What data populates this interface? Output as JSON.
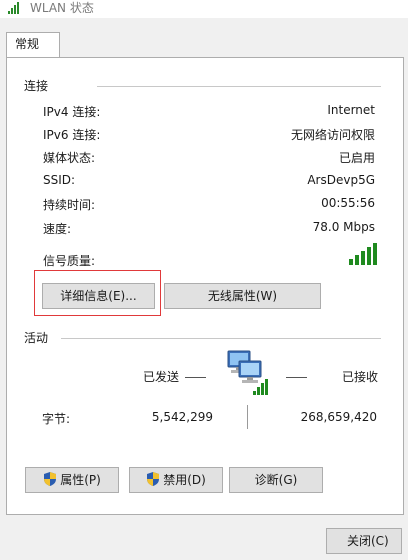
{
  "window": {
    "title": "WLAN 状态"
  },
  "tabs": [
    {
      "label": "常规"
    }
  ],
  "connection": {
    "section_label": "连接",
    "rows": [
      {
        "label": "IPv4 连接:",
        "value": "Internet"
      },
      {
        "label": "IPv6 连接:",
        "value": "无网络访问权限"
      },
      {
        "label": "媒体状态:",
        "value": "已启用"
      },
      {
        "label": "SSID:",
        "value": "ArsDevp5G"
      },
      {
        "label": "持续时间:",
        "value": "00:55:56"
      },
      {
        "label": "速度:",
        "value": "78.0 Mbps"
      }
    ],
    "signal_label": "信号质量:",
    "signal_bars": 5,
    "signal_max": 5,
    "details_button": "详细信息(E)...",
    "wireless_props_button": "无线属性(W)"
  },
  "activity": {
    "section_label": "活动",
    "sent_label": "已发送",
    "received_label": "已接收",
    "bytes_label": "字节:",
    "bytes_sent": "5,542,299",
    "bytes_received": "268,659,420"
  },
  "actions": {
    "properties_button": "属性(P)",
    "disable_button": "禁用(D)",
    "diagnose_button": "诊断(G)"
  },
  "footer": {
    "close_button": "关闭(C)"
  },
  "colors": {
    "signal_green": "#1f8a1f",
    "highlight_red": "#e0393a"
  }
}
